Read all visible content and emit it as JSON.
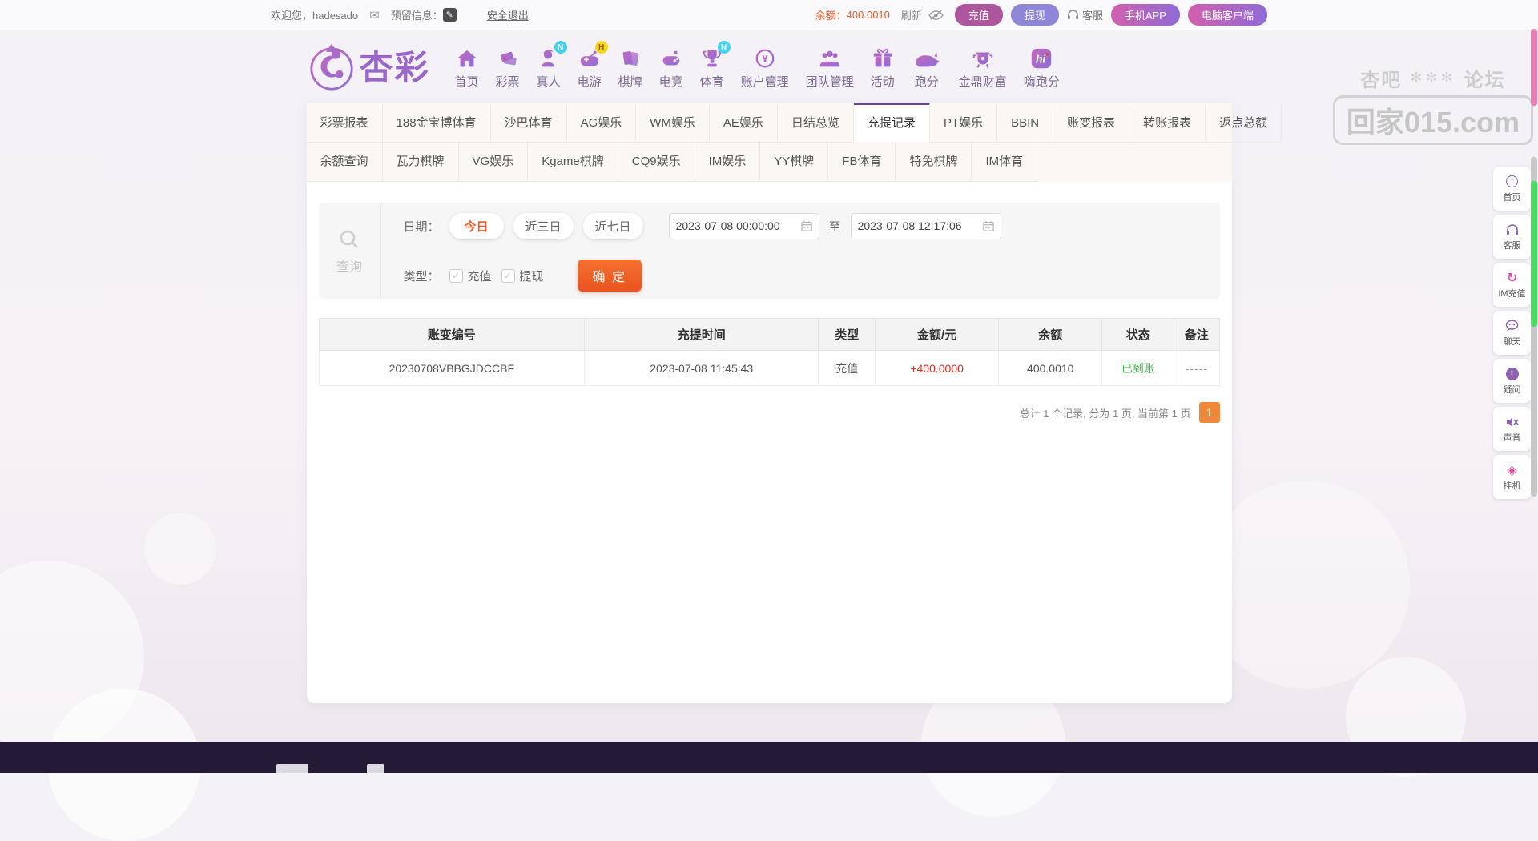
{
  "topbar": {
    "welcome": "欢迎您，hadesado",
    "reserved_label": "预留信息：",
    "logout": "安全退出",
    "balance_label": "余额：",
    "balance_value": "400.0010",
    "refresh": "刷新",
    "deposit_btn": "充值",
    "withdraw_btn": "提现",
    "service_label": "客服",
    "mobile_app_btn": "手机APP",
    "pc_client_btn": "电脑客户端"
  },
  "logo": {
    "text": "杏彩"
  },
  "nav": {
    "items": [
      {
        "label": "首页",
        "icon": "home-icon",
        "badge": ""
      },
      {
        "label": "彩票",
        "icon": "tickets-icon",
        "badge": ""
      },
      {
        "label": "真人",
        "icon": "live-person-icon",
        "badge": "N"
      },
      {
        "label": "电游",
        "icon": "gamepad-icon",
        "badge": "H"
      },
      {
        "label": "棋牌",
        "icon": "cards-icon",
        "badge": ""
      },
      {
        "label": "电竞",
        "icon": "esports-icon",
        "badge": ""
      },
      {
        "label": "体育",
        "icon": "trophy-icon",
        "badge": "N"
      },
      {
        "label": "账户管理",
        "icon": "coin-icon",
        "badge": ""
      },
      {
        "label": "团队管理",
        "icon": "team-icon",
        "badge": ""
      },
      {
        "label": "活动",
        "icon": "gift-icon",
        "badge": ""
      },
      {
        "label": "跑分",
        "icon": "rhino-icon",
        "badge": ""
      },
      {
        "label": "金鼎财富",
        "icon": "treasure-icon",
        "badge": ""
      },
      {
        "label": "嗨跑分",
        "icon": "hi-icon",
        "badge": ""
      }
    ]
  },
  "watermark": {
    "left": "杏吧",
    "right": "论坛",
    "flourish": "✻✼✻",
    "site": "回家015.com"
  },
  "tabs": {
    "row1": [
      "彩票报表",
      "188金宝博体育",
      "沙巴体育",
      "AG娱乐",
      "WM娱乐",
      "AE娱乐",
      "日结总览",
      "充提记录",
      "PT娱乐",
      "BBIN",
      "账变报表",
      "转账报表",
      "返点总额"
    ],
    "active": "充提记录",
    "row2": [
      "余额查询",
      "瓦力棋牌",
      "VG娱乐",
      "Kgame棋牌",
      "CQ9娱乐",
      "IM娱乐",
      "YY棋牌",
      "FB体育",
      "特免棋牌",
      "IM体育"
    ]
  },
  "filter": {
    "query_label": "查询",
    "date_label": "日期：",
    "quick_options": [
      "今日",
      "近三日",
      "近七日"
    ],
    "active_option": "今日",
    "date_from": "2023-07-08 00:00:00",
    "to_label": "至",
    "date_to": "2023-07-08 12:17:06",
    "type_label": "类型：",
    "type_options": [
      "充值",
      "提现"
    ],
    "submit_label": "确 定"
  },
  "table": {
    "headers": [
      "账变编号",
      "充提时间",
      "类型",
      "金额/元",
      "余额",
      "状态",
      "备注"
    ],
    "rows": [
      [
        "20230708VBBGJDCCBF",
        "2023-07-08 11:45:43",
        "充值",
        "+400.0000",
        "400.0010",
        "已到账",
        "-----"
      ]
    ]
  },
  "pagination": {
    "summary": "总计 1 个记录, 分为 1 页, 当前第 1 页",
    "current_page": "1"
  },
  "sidebar": {
    "items": [
      {
        "label": "首页",
        "icon": "back-to-top-icon"
      },
      {
        "label": "客服",
        "icon": "headset-icon"
      },
      {
        "label": "IM充值",
        "icon": "recharge-icon"
      },
      {
        "label": "聊天",
        "icon": "chat-icon"
      },
      {
        "label": "疑问",
        "icon": "question-icon"
      },
      {
        "label": "声音",
        "icon": "mute-icon"
      },
      {
        "label": "挂机",
        "icon": "gem-icon"
      }
    ]
  },
  "icons": {
    "mail": "✉",
    "edit": "✎",
    "check": "✓",
    "up_arrow": "↑",
    "recycle": "↻",
    "gem": "◈",
    "speaker": "◄",
    "cross": "×",
    "exclam": "!"
  },
  "colors": {
    "accent_orange": "#f25b2a",
    "purple": "#8d5fb0",
    "deposit_pink": "#ad569d",
    "withdraw_purple": "#8f86d8",
    "green_ok": "#3db54a",
    "red_amount": "#e02a1f",
    "tab_active_border": "#64478f",
    "footer_bg": "#251a35"
  }
}
